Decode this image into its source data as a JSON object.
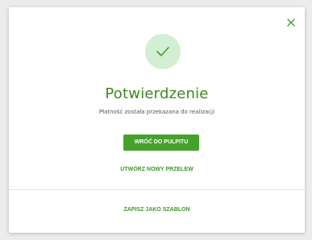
{
  "dialog": {
    "title": "Potwierdzenie",
    "message": "Płatność została przekazana do realizacji",
    "primary_button_label": "WRÓĆ DO PULPITU",
    "new_transfer_link": "UTWÓRZ NOWY PRZELEW",
    "save_template_link": "ZAPISZ JAKO SZABLON"
  },
  "icons": {
    "close": "close-icon",
    "success": "check-icon"
  },
  "colors": {
    "accent": "#46a12b",
    "title": "#3c8a1e",
    "success_circle": "#d2eed3",
    "background": "#ececec"
  }
}
